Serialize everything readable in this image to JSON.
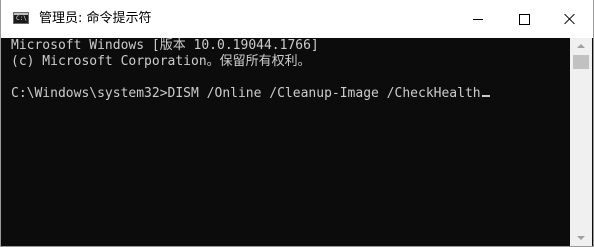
{
  "window": {
    "title": "管理员: 命令提示符",
    "icon": "cmd-icon",
    "icon_text": "C:\\"
  },
  "controls": {
    "minimize_icon": "minimize-icon",
    "maximize_icon": "maximize-icon",
    "close_icon": "close-icon"
  },
  "console": {
    "lines": [
      "Microsoft Windows [版本 10.0.19044.1766]",
      "(c) Microsoft Corporation。保留所有权利。",
      "",
      "C:\\Windows\\system32>DISM /Online /Cleanup-Image /CheckHealth"
    ],
    "text_color": "#cccccc",
    "background": "#0c0c0c"
  }
}
